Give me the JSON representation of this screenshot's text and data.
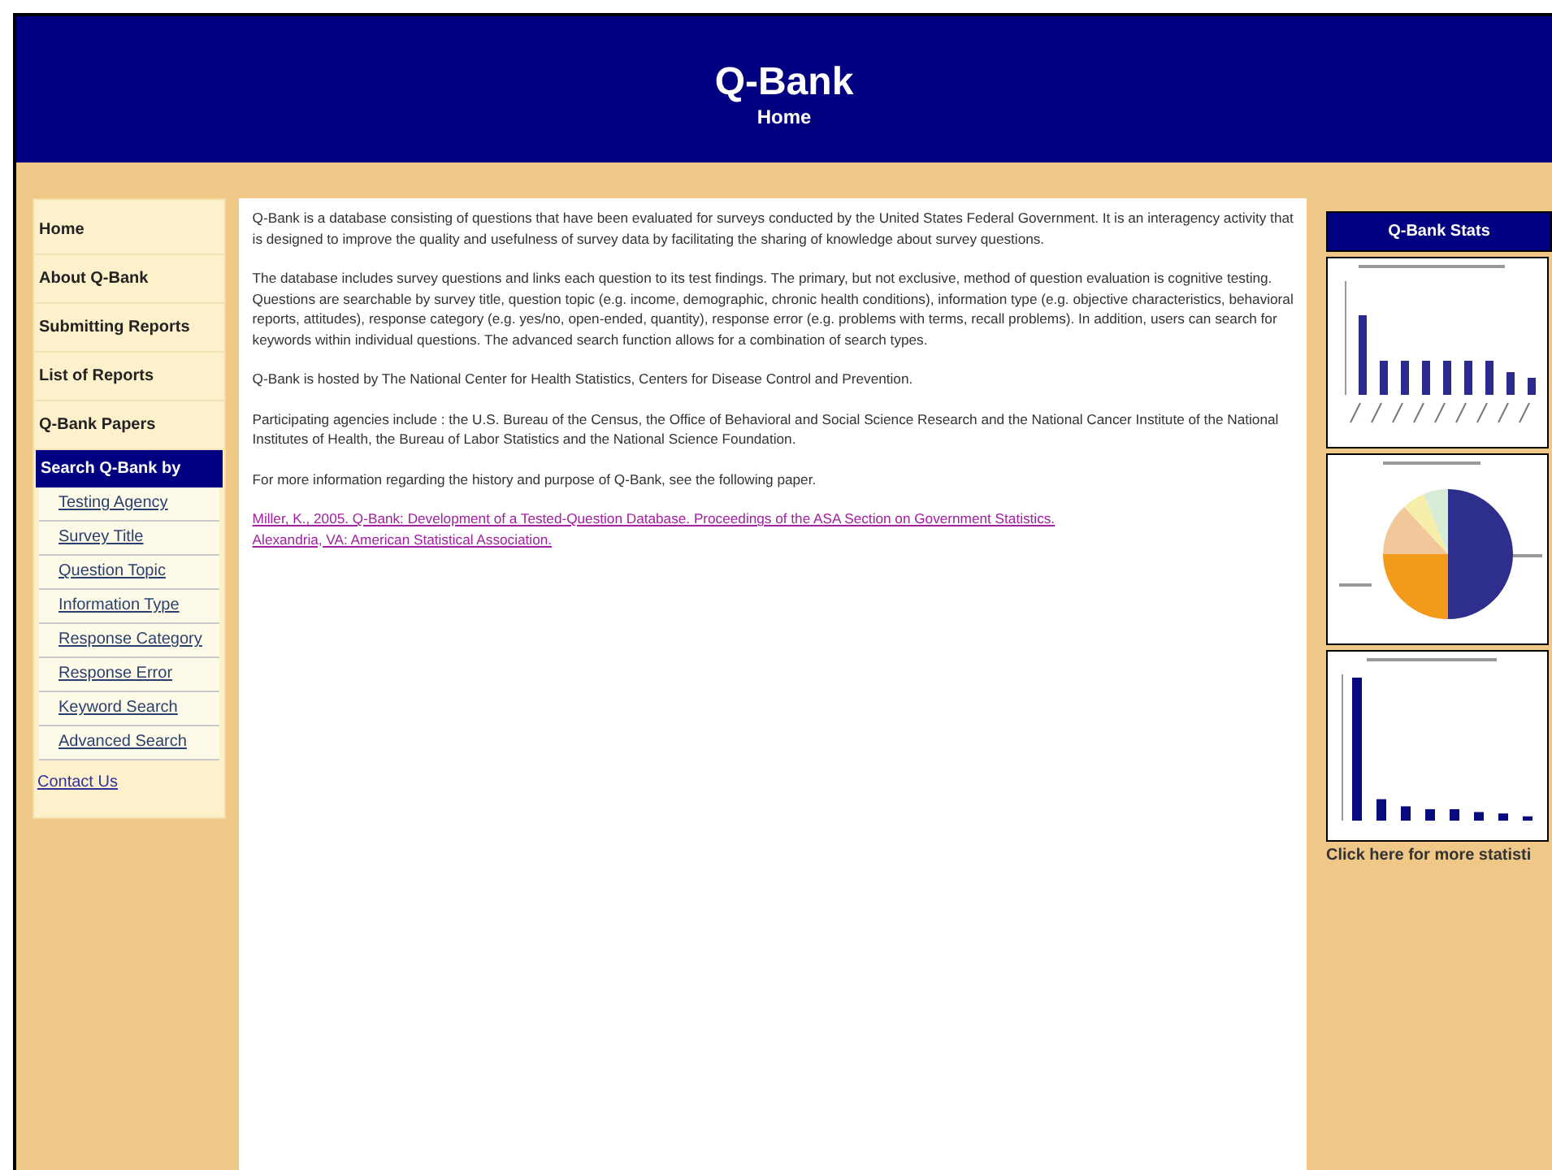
{
  "header": {
    "title": "Q-Bank",
    "subtitle": "Home"
  },
  "sidebar": {
    "items": [
      {
        "label": "Home",
        "kind": "top"
      },
      {
        "label": "About Q-Bank",
        "kind": "top"
      },
      {
        "label": "Submitting Reports",
        "kind": "top"
      },
      {
        "label": "List of Reports",
        "kind": "top"
      },
      {
        "label": "Q-Bank Papers",
        "kind": "top"
      },
      {
        "label": "Search Q-Bank by",
        "kind": "heading"
      },
      {
        "label": "Testing Agency",
        "kind": "sub"
      },
      {
        "label": "Survey Title",
        "kind": "sub"
      },
      {
        "label": "Question Topic",
        "kind": "sub"
      },
      {
        "label": "Information Type",
        "kind": "sub"
      },
      {
        "label": "Response Category",
        "kind": "sub"
      },
      {
        "label": "Response Error",
        "kind": "sub"
      },
      {
        "label": "Keyword Search",
        "kind": "sub"
      },
      {
        "label": "Advanced Search",
        "kind": "sub"
      },
      {
        "label": "Contact Us",
        "kind": "link"
      }
    ]
  },
  "content": {
    "paragraphs": [
      "Q-Bank is a database consisting of questions that have been evaluated for surveys conducted by the United States Federal Government. It is an interagency activity that is designed to improve the quality and usefulness of survey data by facilitating the sharing of knowledge about survey questions.",
      "The database includes survey questions and links each question to its test findings. The primary, but not exclusive, method of question evaluation is cognitive testing. Questions are searchable by survey title, question topic (e.g. income, demographic, chronic health conditions), information type (e.g. objective characteristics, behavioral reports, attitudes), response category (e.g. yes/no, open-ended, quantity), response error (e.g. problems with terms, recall problems). In addition, users can search for keywords within individual questions. The advanced search function allows for a combination of search types.",
      "Q-Bank is hosted by The National Center for Health Statistics, Centers for Disease Control and Prevention.",
      "Participating agencies include : the U.S. Bureau of the Census, the Office of Behavioral and Social Science Research and the National Cancer Institute of the National Institutes of Health, the Bureau of Labor Statistics and the National Science Foundation.",
      "For more information regarding the history and purpose of Q-Bank, see the following paper."
    ],
    "reference_link": "Miller, K., 2005. Q-Bank: Development of a Tested-Question Database. Proceedings of the ASA Section on Government Statistics. Alexandria, VA: American Statistical Association."
  },
  "stats": {
    "title": "Q-Bank Stats",
    "charts": [
      {
        "kind": "bar"
      },
      {
        "kind": "pie"
      },
      {
        "kind": "bar-tall"
      }
    ],
    "more_link": "Click here for more statisti"
  }
}
